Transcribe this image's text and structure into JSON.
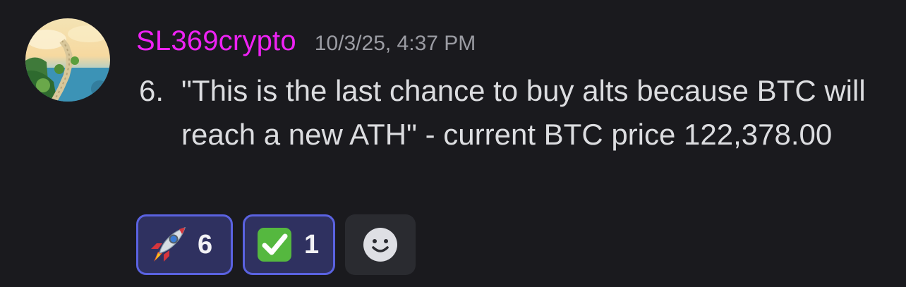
{
  "message": {
    "author": "SL369crypto",
    "author_color": "#ee22f4",
    "timestamp": "10/3/25, 4:37 PM",
    "list_item": {
      "number": "6.",
      "text": "\"This is the last chance to buy alts because BTC will reach a new ATH\" - current BTC price 122,378.00"
    },
    "avatar_icon": "stairway-to-sky-avatar"
  },
  "reactions": [
    {
      "emoji_icon": "rocket-emoji",
      "count": "6"
    },
    {
      "emoji_icon": "check-mark-button-emoji",
      "count": "1"
    }
  ],
  "add_reaction_icon": "smiley-add-reaction-icon",
  "colors": {
    "background": "#1a1a1e",
    "reaction_bg": "#2f3160",
    "reaction_border": "#5a62e0",
    "text": "#dcdde0",
    "timestamp": "#9b9ca3"
  }
}
